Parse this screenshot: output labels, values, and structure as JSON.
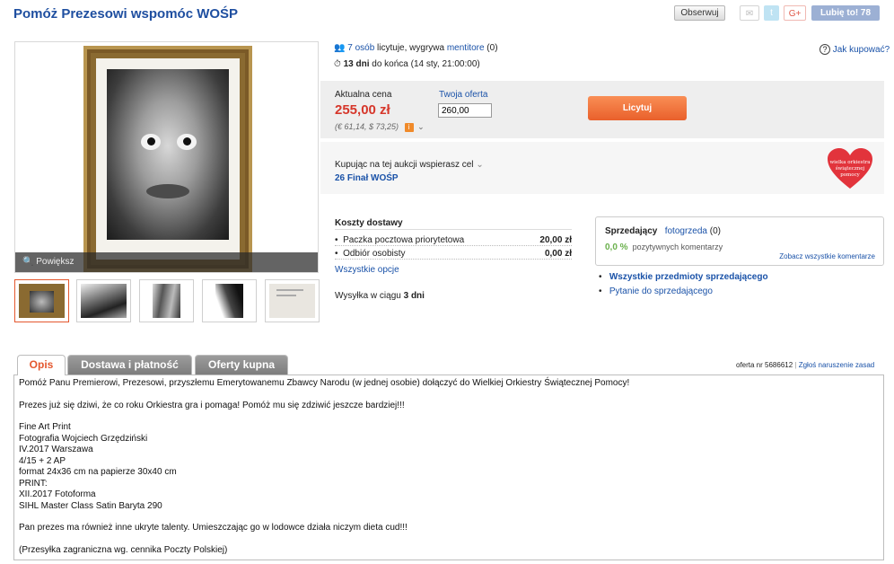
{
  "header": {
    "title": "Pomóż Prezesowi wspomóc WOŚP",
    "observe_label": "Obserwuj",
    "share": {
      "mail": "✉",
      "twitter": "t",
      "gplus": "G+",
      "like": "Lubię to! 78"
    }
  },
  "gallery": {
    "zoom_label": "Powiększ",
    "thumb_count": 5,
    "selected_thumb": 1
  },
  "auction": {
    "bidders_link": "7 osób",
    "bidders_text": " licytuje, wygrywa ",
    "leader": "mentitore",
    "leader_count": " (0)",
    "days_left": "13 dni",
    "ends_text": " do końca (14 sty, 21:00:00)",
    "how_to_buy": "Jak kupować?"
  },
  "price": {
    "label": "Aktualna cena",
    "value": "255,00 zł",
    "conversion": "(€ 61,14, $ 73,25)",
    "your_offer_label": "Twoja oferta",
    "your_offer_value": "260,00",
    "bid_button": "Licytuj"
  },
  "charity": {
    "text": "Kupując na tej aukcji wspierasz cel",
    "goal": "26 Finał WOŚP",
    "logo_text_1": "wielka orkiestra",
    "logo_text_2": "świątecznej",
    "logo_text_3": "pomocy"
  },
  "shipping": {
    "title": "Koszty dostawy",
    "options": [
      {
        "name": "Paczka pocztowa priorytetowa",
        "price": "20,00 zł"
      },
      {
        "name": "Odbiór osobisty",
        "price": "0,00 zł"
      }
    ],
    "all_options": "Wszystkie opcje",
    "ship_time_prefix": "Wysyłka w ciągu ",
    "ship_time_value": "3 dni"
  },
  "seller": {
    "label": "Sprzedający",
    "name": "fotogrzeda",
    "count": "(0)",
    "positive": "0,0 %",
    "positive_text": "pozytywnych komentarzy",
    "all_comments": "Zobacz wszystkie komentarze",
    "links": [
      "Wszystkie przedmioty sprzedającego",
      "Pytanie do sprzedającego"
    ]
  },
  "tabs": [
    "Opis",
    "Dostawa i płatność",
    "Oferty kupna"
  ],
  "offer": {
    "number": "oferta nr 5686612",
    "report": "Zgłoś naruszenie zasad"
  },
  "description": [
    "Pomóż Panu Premierowi, Prezesowi, przyszłemu Emerytowanemu Zbawcy Narodu (w jednej osobie) dołączyć do Wielkiej Orkiestry Świątecznej Pomocy!",
    "Prezes już się dziwi, że co roku Orkiestra gra i pomaga! Pomóż mu się zdziwić jeszcze bardziej!!!",
    "Fine Art Print\nFotografia Wojciech Grzędziński\nIV.2017 Warszawa\n4/15 + 2 AP\nformat 24x36 cm na papierze 30x40 cm\nPRINT:\nXII.2017 Fotoforma\nSIHL Master Class Satin Baryta 290",
    "Pan prezes ma również inne ukryte talenty. Umieszczając go w lodowce działa niczym dieta cud!!!",
    "(Przesyłka zagraniczna wg. cennika Poczty Polskiej)"
  ]
}
